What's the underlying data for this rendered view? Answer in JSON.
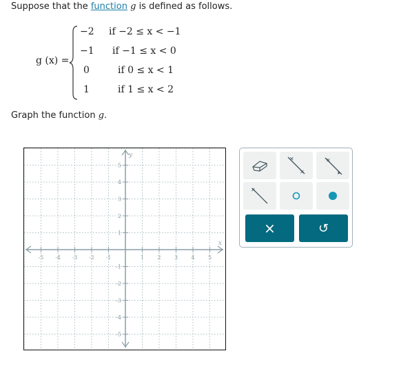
{
  "prompt": {
    "before": "Suppose that the ",
    "link": "function",
    "var": "g",
    "after": " is defined as follows."
  },
  "definition": {
    "lhs": "g (x) =",
    "cases": [
      {
        "value": "−2",
        "condition": "if −2 ≤ x < −1"
      },
      {
        "value": "−1",
        "condition": "if −1 ≤ x < 0"
      },
      {
        "value": "0",
        "condition": "if 0 ≤ x < 1"
      },
      {
        "value": "1",
        "condition": "if 1 ≤ x < 2"
      }
    ]
  },
  "instruction": {
    "text": "Graph the function ",
    "var": "g",
    "end": "."
  },
  "graph": {
    "x_label": "x",
    "y_label": "y",
    "x_ticks": [
      "-5",
      "-4",
      "-3",
      "-2",
      "-1",
      "1",
      "2",
      "3",
      "4",
      "5"
    ],
    "y_ticks": [
      "5",
      "4",
      "3",
      "2",
      "1",
      "-1",
      "-2",
      "-3",
      "-4",
      "-5"
    ],
    "xlim": [
      -6,
      6
    ],
    "ylim": [
      -6,
      6
    ],
    "grid": true
  },
  "tools": [
    {
      "icon": "eraser-icon"
    },
    {
      "icon": "segment-icon"
    },
    {
      "icon": "ray-icon"
    },
    {
      "icon": "ray-end-icon"
    },
    {
      "icon": "open-circle-icon"
    },
    {
      "icon": "closed-circle-icon"
    }
  ],
  "actions": {
    "clear": "×",
    "undo": "↺"
  },
  "colors": {
    "accent": "#036a7f",
    "point": "#1496b4",
    "axis": "#8a9ea6"
  }
}
